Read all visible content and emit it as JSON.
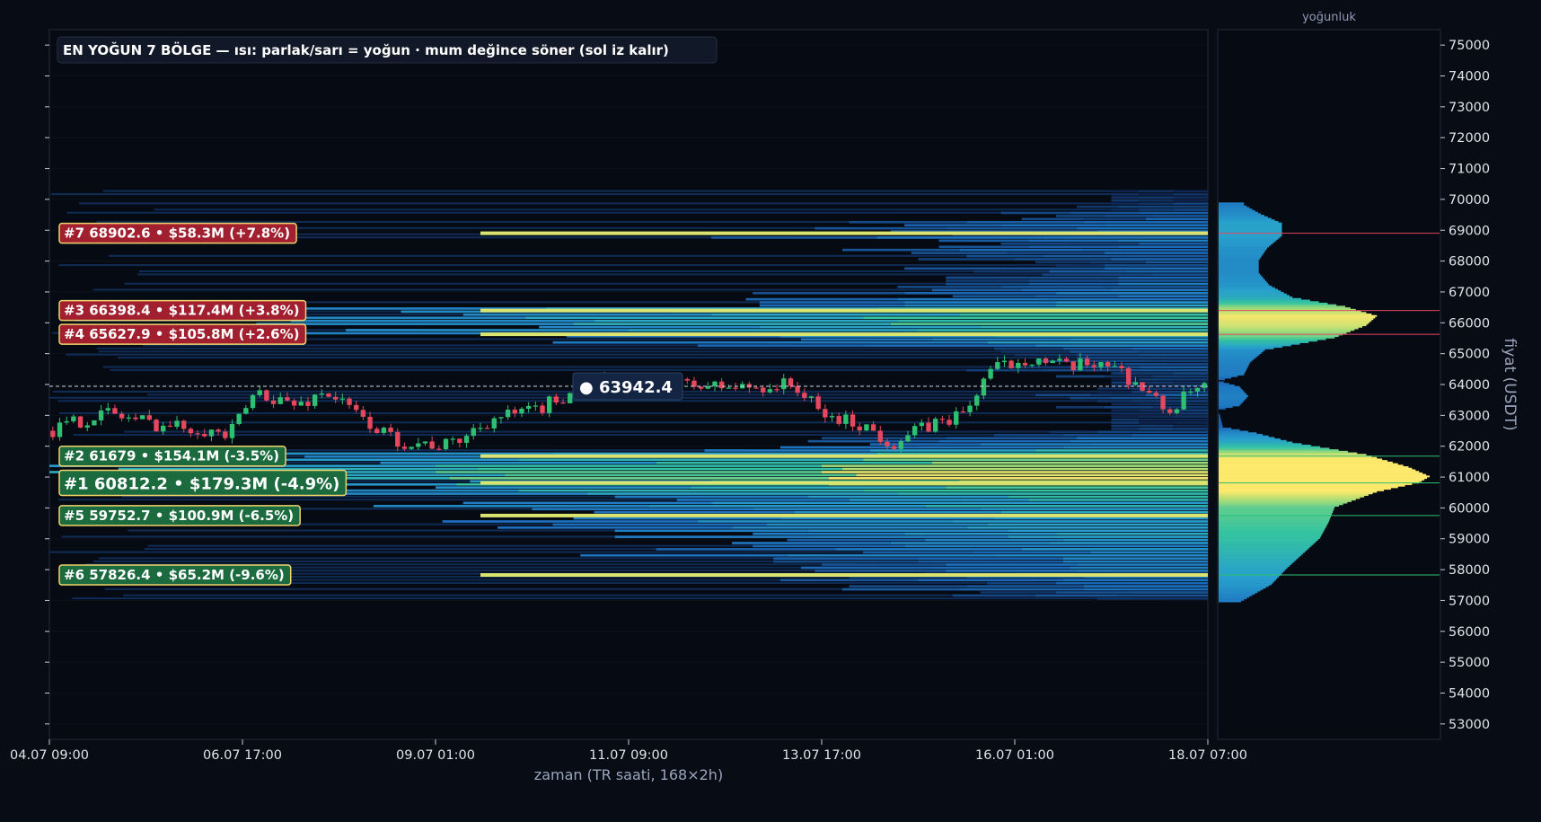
{
  "chart_data": {
    "type": "heatmap",
    "title": "EN YOĞUN 7 BÖLGE — ısı: parlak/sarı = yoğun · mum değince söner (sol iz kalır)",
    "xlabel": "zaman (TR saati, 168×2h)",
    "ylabel": "fiyat (USDT)",
    "profile_title": "yoğunluk",
    "ylim": [
      52500,
      75500
    ],
    "y_ticks": [
      53000,
      54000,
      55000,
      56000,
      57000,
      58000,
      59000,
      60000,
      61000,
      62000,
      63000,
      64000,
      65000,
      66000,
      67000,
      68000,
      69000,
      70000,
      71000,
      72000,
      73000,
      74000,
      75000
    ],
    "x_ticks": [
      "04.07 09:00",
      "06.07 17:00",
      "09.07 01:00",
      "11.07 09:00",
      "13.07 17:00",
      "16.07 01:00",
      "18.07 07:00"
    ],
    "x_count": 168,
    "current_price": 63942.4,
    "current_price_label": "● 63942.4",
    "zones": [
      {
        "rank": 7,
        "price": 68902.6,
        "label": "#7  68902.6  •  $58.3M  (+7.8%)",
        "side": "above"
      },
      {
        "rank": 3,
        "price": 66398.4,
        "label": "#3  66398.4  •  $117.4M  (+3.8%)",
        "side": "above"
      },
      {
        "rank": 4,
        "price": 65627.9,
        "label": "#4  65627.9  •  $105.8M  (+2.6%)",
        "side": "above"
      },
      {
        "rank": 2,
        "price": 61679,
        "label": "#2  61679  •  $154.1M  (-3.5%)",
        "side": "below"
      },
      {
        "rank": 1,
        "price": 60812.2,
        "label": "#1  60812.2  •  $179.3M  (-4.9%)",
        "side": "below"
      },
      {
        "rank": 5,
        "price": 59752.7,
        "label": "#5  59752.7  •  $100.9M  (-6.5%)",
        "side": "below"
      },
      {
        "rank": 6,
        "price": 57826.4,
        "label": "#6  57826.4  •  $65.2M  (-9.6%)",
        "side": "below"
      }
    ],
    "density_profile": [
      {
        "price": 57000,
        "v": 0.12
      },
      {
        "price": 57500,
        "v": 0.25
      },
      {
        "price": 58000,
        "v": 0.32
      },
      {
        "price": 58500,
        "v": 0.4
      },
      {
        "price": 59000,
        "v": 0.48
      },
      {
        "price": 59500,
        "v": 0.52
      },
      {
        "price": 60000,
        "v": 0.55
      },
      {
        "price": 60500,
        "v": 0.75
      },
      {
        "price": 60800,
        "v": 0.95
      },
      {
        "price": 61000,
        "v": 1.0
      },
      {
        "price": 61300,
        "v": 0.9
      },
      {
        "price": 61700,
        "v": 0.7
      },
      {
        "price": 62100,
        "v": 0.35
      },
      {
        "price": 62400,
        "v": 0.18
      },
      {
        "price": 62600,
        "v": 0.02
      },
      {
        "price": 63150,
        "v": 0.0
      },
      {
        "price": 63300,
        "v": 0.1
      },
      {
        "price": 63600,
        "v": 0.14
      },
      {
        "price": 63900,
        "v": 0.1
      },
      {
        "price": 64100,
        "v": 0.0
      },
      {
        "price": 64300,
        "v": 0.12
      },
      {
        "price": 64700,
        "v": 0.15
      },
      {
        "price": 65100,
        "v": 0.22
      },
      {
        "price": 65500,
        "v": 0.55
      },
      {
        "price": 65900,
        "v": 0.7
      },
      {
        "price": 66200,
        "v": 0.75
      },
      {
        "price": 66500,
        "v": 0.6
      },
      {
        "price": 66800,
        "v": 0.35
      },
      {
        "price": 67200,
        "v": 0.24
      },
      {
        "price": 67600,
        "v": 0.19
      },
      {
        "price": 68000,
        "v": 0.19
      },
      {
        "price": 68400,
        "v": 0.23
      },
      {
        "price": 68800,
        "v": 0.3
      },
      {
        "price": 69200,
        "v": 0.3
      },
      {
        "price": 69500,
        "v": 0.2
      },
      {
        "price": 69800,
        "v": 0.12
      }
    ],
    "colors": {
      "background": "#080c14",
      "bull": "#2fbf71",
      "bear": "#e5485d",
      "heat_low": "#1e88d6",
      "heat_mid": "#35c7a4",
      "heat_high": "#fde96c",
      "zone_above": "#a11f2e",
      "zone_below": "#1c6b3f",
      "zone_border": "#f0d36b"
    }
  }
}
